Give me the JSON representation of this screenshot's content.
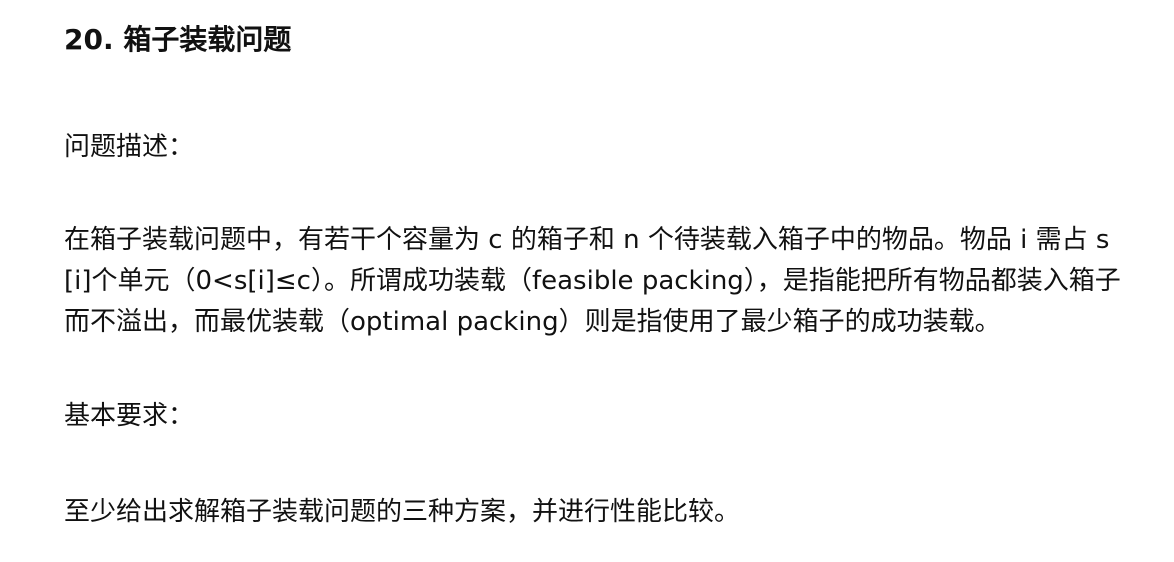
{
  "document": {
    "title": "20. 箱子装载问题",
    "problem_heading": "问题描述：",
    "problem_text": "在箱子装载问题中，有若干个容量为 c 的箱子和 n 个待装载入箱子中的物品。物品 i 需占 s[i]个单元（0<s[i]≤c）。所谓成功装载（feasible packing），是指能把所有物品都装入箱子而不溢出，而最优装载（optimal packing）则是指使用了最少箱子的成功装载。",
    "requirements_heading": "基本要求：",
    "requirements_text": "至少给出求解箱子装载问题的三种方案，并进行性能比较。"
  }
}
